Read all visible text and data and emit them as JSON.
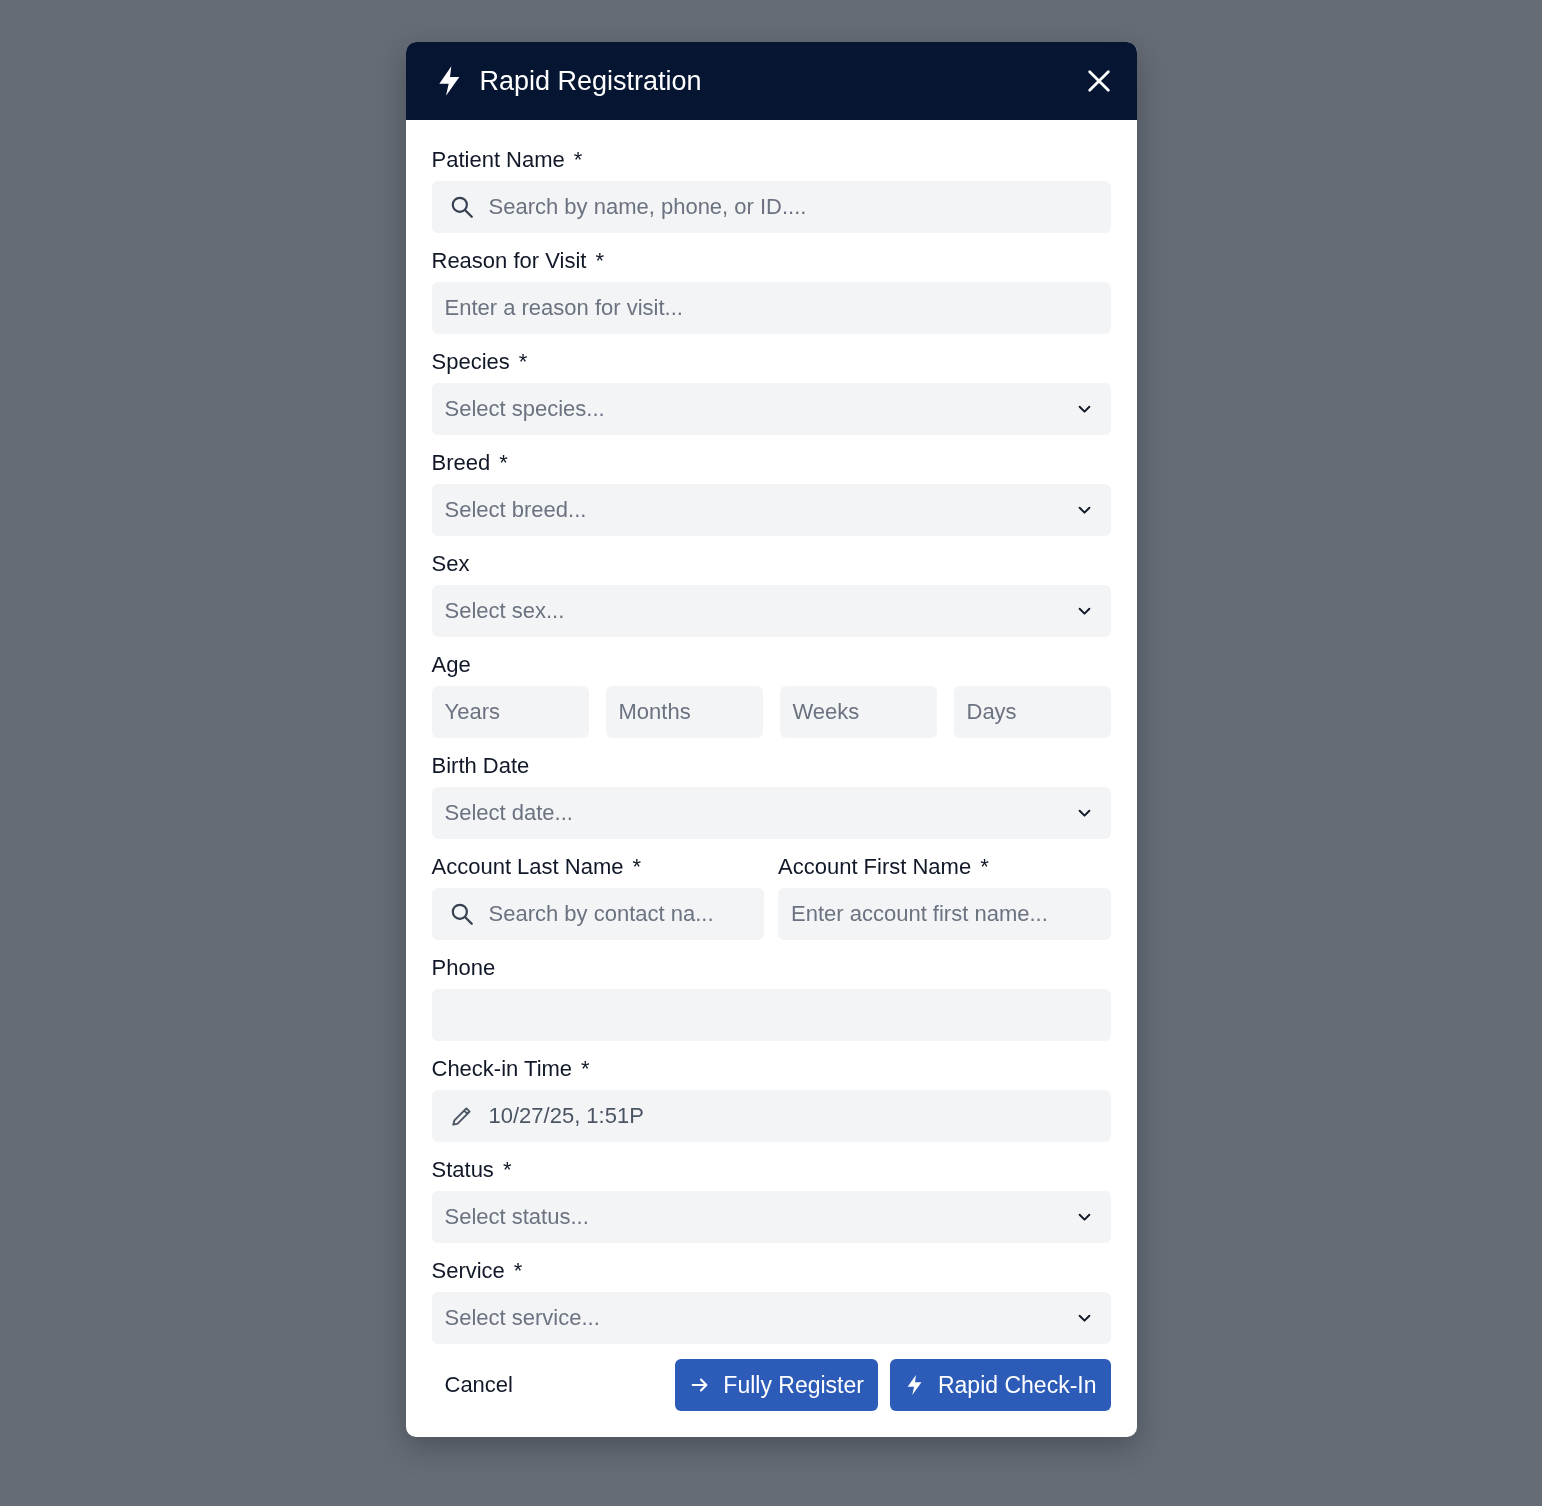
{
  "dialog": {
    "title": "Rapid Registration"
  },
  "fields": [
    {
      "kind": "search",
      "label": "Patient Name",
      "required_mark": "*",
      "placeholder": "Search by name, phone, or ID...."
    },
    {
      "kind": "text",
      "label": "Reason for Visit",
      "required_mark": "*",
      "placeholder": "Enter a reason for visit..."
    },
    {
      "kind": "select",
      "label": "Species",
      "required_mark": "*",
      "placeholder": "Select species..."
    },
    {
      "kind": "select",
      "label": "Breed",
      "required_mark": "*",
      "placeholder": "Select breed..."
    },
    {
      "kind": "select",
      "label": "Sex",
      "placeholder": "Select sex..."
    },
    {
      "kind": "group",
      "label": "Age",
      "parts": [
        {
          "placeholder": "Years"
        },
        {
          "placeholder": "Months"
        },
        {
          "placeholder": "Weeks"
        },
        {
          "placeholder": "Days"
        }
      ]
    },
    {
      "kind": "select",
      "label": "Birth Date",
      "placeholder": "Select date..."
    },
    {
      "kind": "pair",
      "items": [
        {
          "kind": "search",
          "label": "Account Last Name",
          "required_mark": "*",
          "placeholder": "Search by contact na..."
        },
        {
          "kind": "text",
          "label": "Account First Name",
          "required_mark": "*",
          "placeholder": "Enter account first name..."
        }
      ]
    },
    {
      "kind": "text",
      "label": "Phone"
    },
    {
      "kind": "edit",
      "label": "Check-in Time",
      "required_mark": "*",
      "value": "10/27/25, 1:51P"
    },
    {
      "kind": "select",
      "label": "Status",
      "required_mark": "*",
      "placeholder": "Select status..."
    },
    {
      "kind": "select",
      "label": "Service",
      "required_mark": "*",
      "placeholder": "Select service..."
    }
  ],
  "actions": {
    "cancel": "Cancel",
    "buttons": [
      {
        "label": "Fully Register",
        "kind": "arrow"
      },
      {
        "label": "Rapid Check-In",
        "kind": "bolt"
      }
    ]
  }
}
